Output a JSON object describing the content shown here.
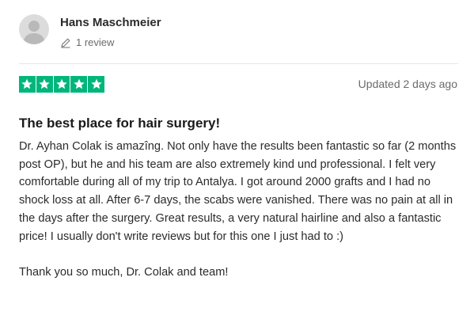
{
  "reviewer": {
    "name": "Hans Maschmeier",
    "review_count": "1 review",
    "avatar_icon": "user-silhouette-icon",
    "pencil_icon": "pencil-icon"
  },
  "rating": {
    "stars": 5,
    "max_stars": 5,
    "star_color": "#00b67a",
    "star_icon": "star-icon"
  },
  "meta": {
    "updated": "Updated 2 days ago"
  },
  "review": {
    "title": "The best place for hair surgery!",
    "paragraphs": [
      "Dr. Ayhan Colak is amazîng. Not only have the results been fantastic so far (2 months post OP), but he and his team are also extremely kind und professional. I felt very comfortable during all of my trip to Antalya. I got around 2000 grafts and I had no shock loss at all. After 6-7 days, the scabs were vanished. There was no pain at all in the days after the surgery. Great results, a very natural hairline and also a fantastic price! I usually don't write reviews but for this one I just had to :)",
      "Thank you so much, Dr. Colak and team!"
    ]
  }
}
